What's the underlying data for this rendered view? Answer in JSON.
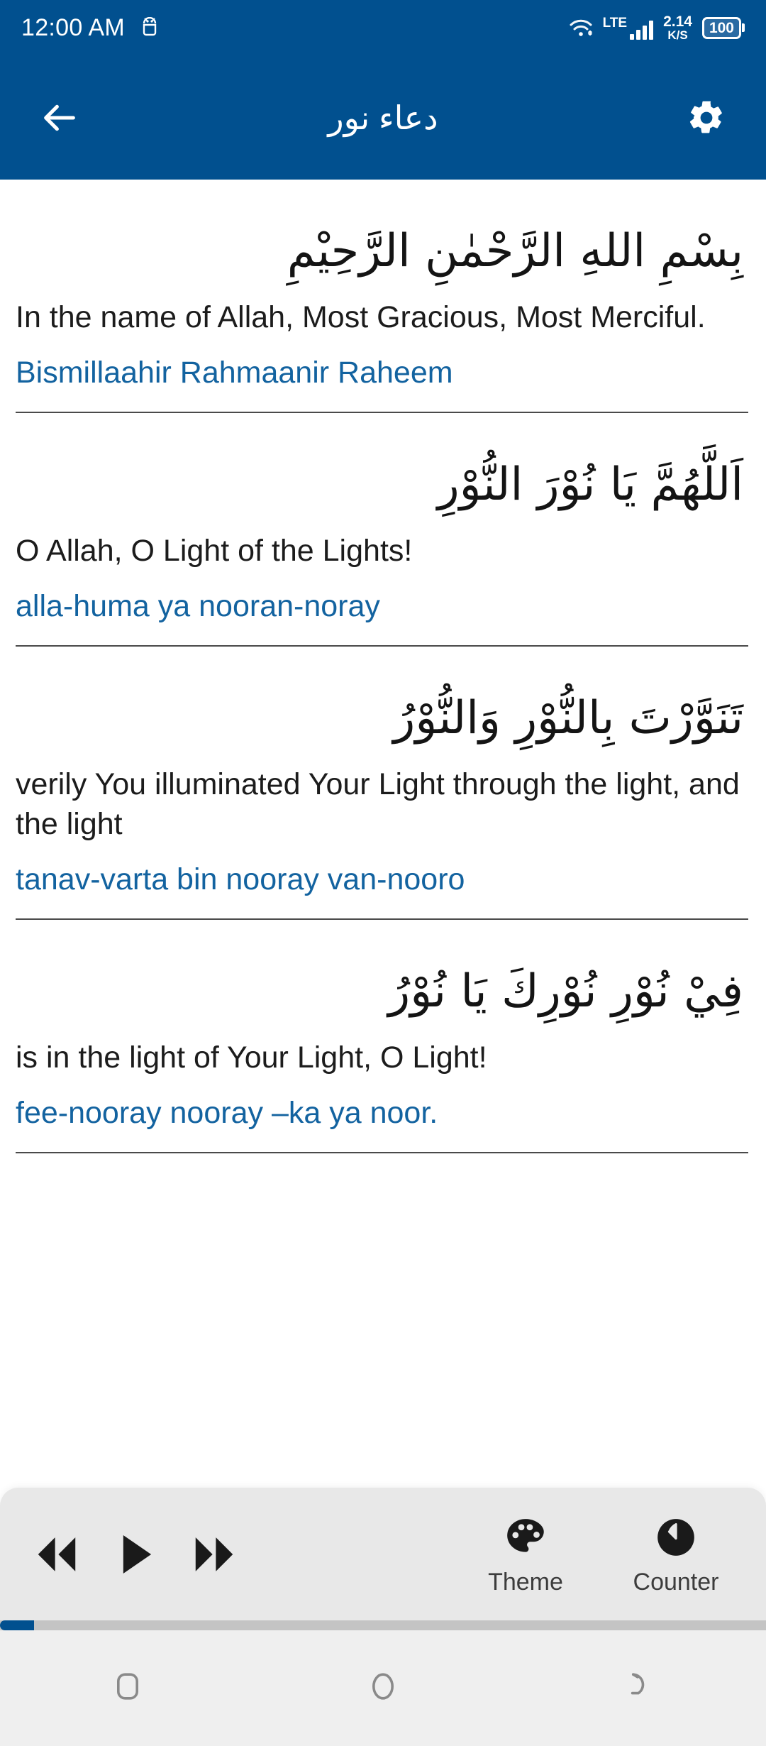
{
  "statusbar": {
    "time": "12:00 AM",
    "android_icon": "android-robot-icon",
    "wifi_icon": "wifi-icon",
    "network_type": "LTE",
    "signal_icon": "signal-bars-icon",
    "net_speed_value": "2.14",
    "net_speed_unit": "K/S",
    "battery_percent": "100"
  },
  "appbar": {
    "back_icon": "back-arrow-icon",
    "title": "دعاء نور",
    "settings_icon": "gear-icon",
    "background_color": "#01508f"
  },
  "colors": {
    "primary": "#01508f",
    "translation_text": "#1c1c1c",
    "transliteration_text": "#1363a0",
    "panel_background": "#e8e8e8",
    "navbar_background": "#efefef"
  },
  "verses": [
    {
      "arabic": "بِسْمِ اللهِ الرَّحْمٰنِ الرَّحِيْمِ",
      "translation": "In the name of Allah, Most Gracious, Most Merciful.",
      "transliteration": "Bismillaahir Rahmaanir Raheem"
    },
    {
      "arabic": "اَللَّهُمَّ يَا نُوْرَ النُّوْرِ",
      "translation": "O Allah, O Light of the Lights!",
      "transliteration": "alla-huma ya nooran-noray"
    },
    {
      "arabic": "تَنَوَّرْتَ بِالنُّوْرِ وَالنُّوْرُ",
      "translation": "verily You illuminated Your Light through the light, and the light",
      "transliteration": "tanav-varta bin nooray van-nooro"
    },
    {
      "arabic": "فِيْ نُوْرِ نُوْرِكَ يَا نُوْرُ",
      "translation": "is in the light of Your Light, O Light!",
      "transliteration": "fee-nooray nooray –ka ya noor."
    }
  ],
  "player": {
    "rewind_icon": "rewind-icon",
    "play_icon": "play-icon",
    "forward_icon": "fast-forward-icon",
    "theme_icon": "palette-icon",
    "theme_label": "Theme",
    "counter_icon": "counter-icon",
    "counter_label": "Counter"
  },
  "navbar": {
    "recents_icon": "recents-square-icon",
    "home_icon": "home-circle-icon",
    "back_icon": "back-arrow-nav-icon"
  }
}
